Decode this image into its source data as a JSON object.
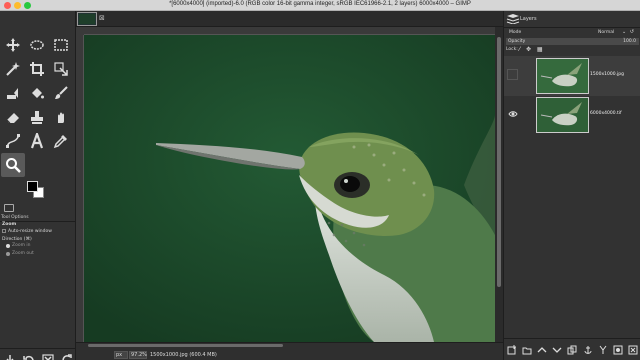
{
  "window": {
    "title": "*[6000x4000] (imported)-6.0 (RGB color 16-bit gamma integer, sRGB IEC61966-2.1, 2 layers) 6000x4000 – GIMP"
  },
  "toolbox": {
    "tools": [
      "move-tool-icon",
      "ellipse-select-icon",
      "rect-select-icon",
      "fuzzy-select-icon",
      "crop-icon",
      "transform-icon",
      "warp-icon",
      "paint-bucket-icon",
      "paintbrush-icon",
      "eraser-icon",
      "clone-icon",
      "smudge-icon",
      "paths-icon",
      "text-icon",
      "color-picker-icon",
      "zoom-icon"
    ],
    "active_tool": "zoom-icon",
    "colors": {
      "foreground": "#000000",
      "background": "#ffffff"
    }
  },
  "tool_options": {
    "tab_label": "Tool Options",
    "title": "Zoom",
    "auto_resize_label": "Auto-resize window",
    "direction_label": "Direction  (⌘)",
    "zoom_in_label": "Zoom in",
    "zoom_out_label": "Zoom out"
  },
  "statusbar": {
    "units": "px",
    "zoom": "97.2%",
    "info": "1500x1000.jpg (600.4 MB)"
  },
  "layers_panel": {
    "tab_label": "Layers",
    "mode_label": "Mode",
    "mode_value": "Normal",
    "opacity_label": "Opacity",
    "opacity_value": "100.0",
    "lock_label": "Lock:",
    "layers": [
      {
        "name": "1500x1000.jpg",
        "visible": false
      },
      {
        "name": "6000x4000.tif",
        "visible": true
      }
    ]
  },
  "colors": {
    "canvas_bg": "#1d4a2b",
    "panel_bg": "#323232"
  }
}
